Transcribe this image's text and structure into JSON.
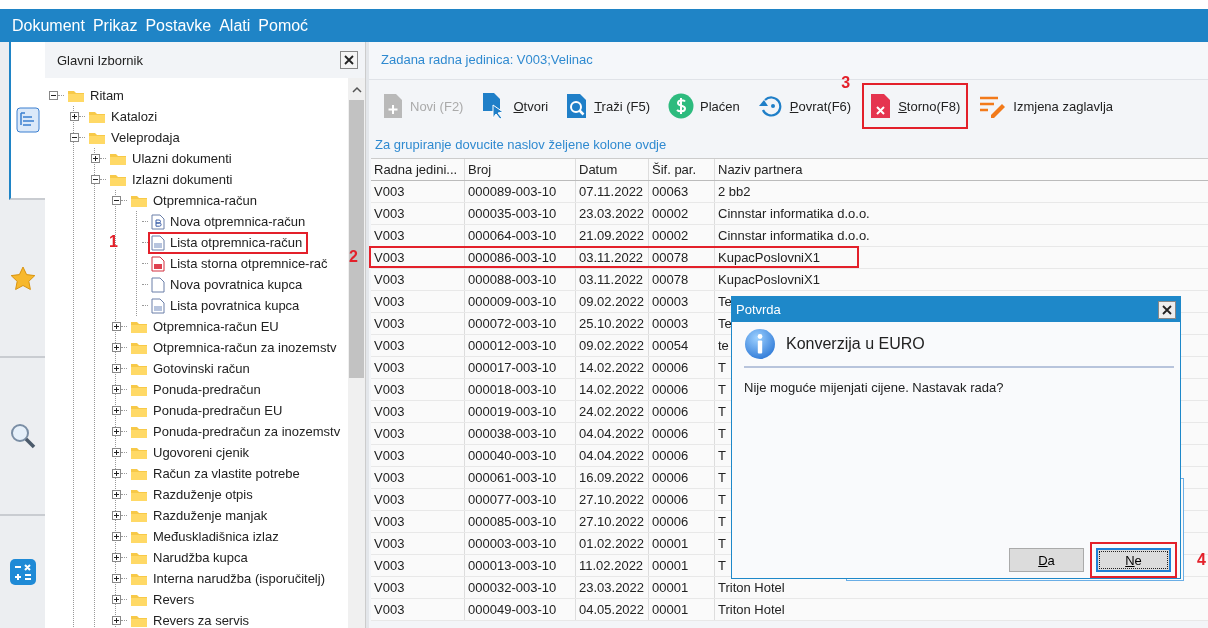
{
  "menu": [
    {
      "label": "Dokument"
    },
    {
      "label": "Prikaz"
    },
    {
      "label": "Postavke"
    },
    {
      "label": "Alati"
    },
    {
      "label": "Pomoć"
    }
  ],
  "side_tabs": [
    {
      "kind": "tree",
      "selected": true
    },
    {
      "kind": "favorites",
      "selected": false
    },
    {
      "kind": "search",
      "selected": false
    },
    {
      "kind": "calculator",
      "selected": false
    }
  ],
  "tree_panel": {
    "title": "Glavni Izbornik",
    "items": [
      {
        "label": "Ritam",
        "kind": "folder",
        "expanded": true,
        "children": [
          {
            "label": "Katalozi",
            "kind": "folder",
            "expanded": false
          },
          {
            "label": "Veleprodaja",
            "kind": "folder",
            "expanded": true,
            "children": [
              {
                "label": "Ulazni dokumenti",
                "kind": "folder",
                "expanded": false
              },
              {
                "label": "Izlazni dokumenti",
                "kind": "folder",
                "expanded": true,
                "children": [
                  {
                    "label": "Otpremnica-račun",
                    "kind": "folder",
                    "expanded": true,
                    "children": [
                      {
                        "label": "Nova otpremnica-račun",
                        "kind": "doc-new"
                      },
                      {
                        "label": "Lista otpremnica-račun",
                        "kind": "doc-list",
                        "callout": "1"
                      },
                      {
                        "label": "Lista storna otpremnice-rač",
                        "kind": "doc-red"
                      },
                      {
                        "label": "Nova povratnica kupca",
                        "kind": "doc-blank"
                      },
                      {
                        "label": "Lista povratnica kupca",
                        "kind": "doc-list"
                      }
                    ]
                  },
                  {
                    "label": "Otpremnica-račun EU",
                    "kind": "folder",
                    "expanded": false
                  },
                  {
                    "label": "Otpremnica-račun za inozemstv",
                    "kind": "folder",
                    "expanded": false
                  },
                  {
                    "label": "Gotovinski račun",
                    "kind": "folder",
                    "expanded": false
                  },
                  {
                    "label": "Ponuda-predračun",
                    "kind": "folder",
                    "expanded": false
                  },
                  {
                    "label": "Ponuda-predračun EU",
                    "kind": "folder",
                    "expanded": false
                  },
                  {
                    "label": "Ponuda-predračun za inozemstv",
                    "kind": "folder",
                    "expanded": false
                  },
                  {
                    "label": "Ugovoreni cjenik",
                    "kind": "folder",
                    "expanded": false
                  },
                  {
                    "label": "Račun za vlastite potrebe",
                    "kind": "folder",
                    "expanded": false
                  },
                  {
                    "label": "Razduženje otpis",
                    "kind": "folder",
                    "expanded": false
                  },
                  {
                    "label": "Razduženje manjak",
                    "kind": "folder",
                    "expanded": false
                  },
                  {
                    "label": "Međuskladišnica izlaz",
                    "kind": "folder",
                    "expanded": false
                  },
                  {
                    "label": "Narudžba kupca",
                    "kind": "folder",
                    "expanded": false
                  },
                  {
                    "label": "Interna narudžba (isporučitelj)",
                    "kind": "folder",
                    "expanded": false
                  },
                  {
                    "label": "Revers",
                    "kind": "folder",
                    "expanded": false
                  },
                  {
                    "label": "Revers za servis",
                    "kind": "folder",
                    "expanded": false
                  }
                ]
              }
            ]
          }
        ]
      }
    ]
  },
  "unit_label": "Zadana radna jedinica: V003;Velinac",
  "toolbar": [
    {
      "kind": "new",
      "label": "Novi (F2)",
      "disabled": true,
      "accel": false
    },
    {
      "kind": "open",
      "label": "Otvori",
      "disabled": false,
      "accel": true
    },
    {
      "kind": "search",
      "label": "Traži (F5)",
      "disabled": false,
      "accel": true
    },
    {
      "kind": "paid",
      "label": "Plaćen",
      "disabled": false,
      "accel": false
    },
    {
      "kind": "return",
      "label": "Povrat(F6)",
      "disabled": false,
      "accel": true
    },
    {
      "kind": "cancel",
      "label": "Storno(F8)",
      "disabled": false,
      "accel": true,
      "callout": "3"
    },
    {
      "kind": "edit",
      "label": "Izmjena zaglavlja",
      "disabled": false,
      "accel": false
    }
  ],
  "group_hint": "Za grupiranje dovucite naslov željene kolone ovdje",
  "table": {
    "columns": [
      "Radna jedini...",
      "Broj",
      "Datum",
      "Šif. par.",
      "Naziv partnera"
    ],
    "rows": [
      {
        "cells": [
          "V003",
          "000089-003-10",
          "07.11.2022",
          "00063",
          "2 bb2"
        ]
      },
      {
        "cells": [
          "V003",
          "000035-003-10",
          "23.03.2022",
          "00002",
          "Cinnstar informatika d.o.o."
        ]
      },
      {
        "cells": [
          "V003",
          "000064-003-10",
          "21.09.2022",
          "00002",
          "Cinnstar informatika d.o.o."
        ]
      },
      {
        "cells": [
          "V003",
          "000086-003-10",
          "03.11.2022",
          "00078",
          "KupacPoslovniX1"
        ],
        "callout": "2"
      },
      {
        "cells": [
          "V003",
          "000088-003-10",
          "03.11.2022",
          "00078",
          "KupacPoslovniX1"
        ]
      },
      {
        "cells": [
          "V003",
          "000009-003-10",
          "09.02.2022",
          "00003",
          "Te"
        ]
      },
      {
        "cells": [
          "V003",
          "000072-003-10",
          "25.10.2022",
          "00003",
          "Te"
        ]
      },
      {
        "cells": [
          "V003",
          "000012-003-10",
          "09.02.2022",
          "00054",
          "te"
        ]
      },
      {
        "cells": [
          "V003",
          "000017-003-10",
          "14.02.2022",
          "00006",
          "T"
        ]
      },
      {
        "cells": [
          "V003",
          "000018-003-10",
          "14.02.2022",
          "00006",
          "T"
        ]
      },
      {
        "cells": [
          "V003",
          "000019-003-10",
          "24.02.2022",
          "00006",
          "T"
        ]
      },
      {
        "cells": [
          "V003",
          "000038-003-10",
          "04.04.2022",
          "00006",
          "T"
        ]
      },
      {
        "cells": [
          "V003",
          "000040-003-10",
          "04.04.2022",
          "00006",
          "T"
        ]
      },
      {
        "cells": [
          "V003",
          "000061-003-10",
          "16.09.2022",
          "00006",
          "T"
        ]
      },
      {
        "cells": [
          "V003",
          "000077-003-10",
          "27.10.2022",
          "00006",
          "T"
        ]
      },
      {
        "cells": [
          "V003",
          "000085-003-10",
          "27.10.2022",
          "00006",
          "T"
        ]
      },
      {
        "cells": [
          "V003",
          "000003-003-10",
          "01.02.2022",
          "00001",
          "T"
        ]
      },
      {
        "cells": [
          "V003",
          "000013-003-10",
          "11.02.2022",
          "00001",
          "T"
        ]
      },
      {
        "cells": [
          "V003",
          "000032-003-10",
          "23.03.2022",
          "00001",
          "Triton Hotel"
        ]
      },
      {
        "cells": [
          "V003",
          "000049-003-10",
          "04.05.2022",
          "00001",
          "Triton Hotel"
        ]
      }
    ]
  },
  "dialog": {
    "title": "Potvrda",
    "heading": "Konverzija u EURO",
    "message": "Nije moguće mijenjati cijene. Nastavak rada?",
    "buttons": [
      {
        "label": "Da",
        "focused": false,
        "accel": true
      },
      {
        "label": "Ne",
        "focused": true,
        "accel": true,
        "callout": "4"
      }
    ]
  }
}
